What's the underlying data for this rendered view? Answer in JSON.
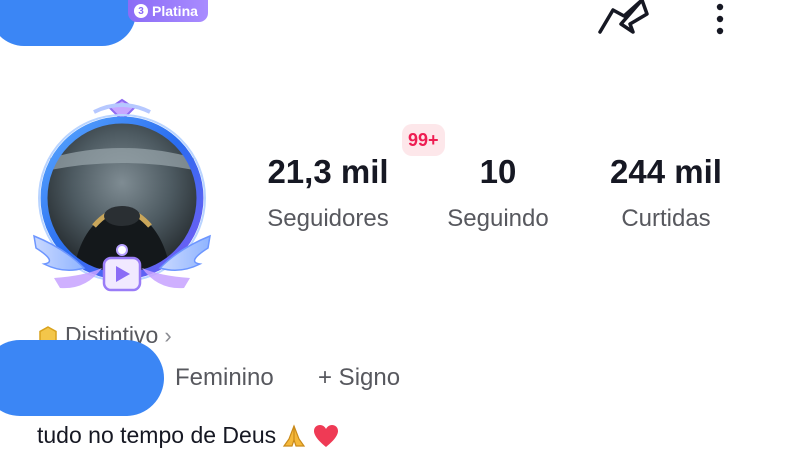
{
  "header": {
    "tier_level": "3",
    "tier_label": "Platina",
    "share_icon": "share-arrow-icon",
    "more_icon": "more-vertical-icon"
  },
  "notification": {
    "count": "99+"
  },
  "stats": [
    {
      "value": "21,3 mil",
      "label": "Seguidores"
    },
    {
      "value": "10",
      "label": "Seguindo"
    },
    {
      "value": "244 mil",
      "label": "Curtidas"
    }
  ],
  "profile": {
    "badge_label": "Distintivo",
    "badge_chevron": "›",
    "gender": "Feminino",
    "sign": "+ Signo",
    "bio": "tudo no tempo de Deus"
  },
  "colors": {
    "accent": "#ee1d52",
    "tier": "#8b6cf6",
    "redaction": "#3b86f5"
  }
}
